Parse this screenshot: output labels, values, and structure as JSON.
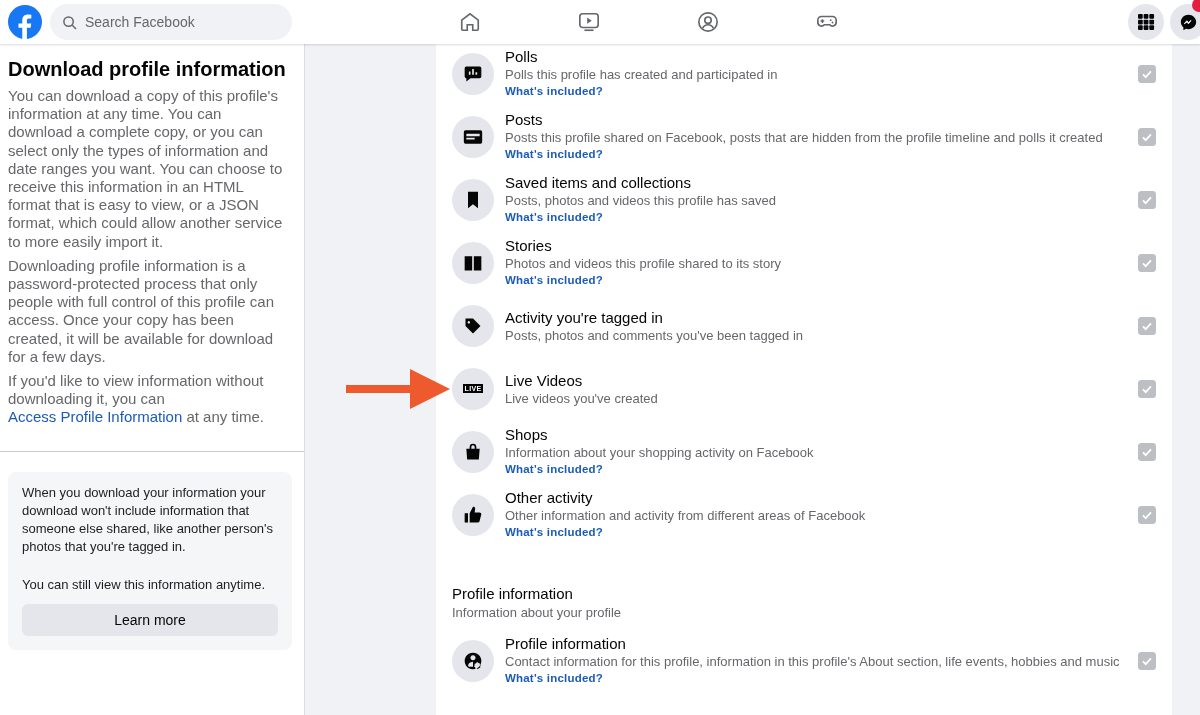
{
  "header": {
    "search": {
      "placeholder": "Search Facebook"
    },
    "notification_badge": true
  },
  "sidebar": {
    "title": "Download profile information",
    "paragraphs": [
      "You can download a copy of this profile's information at any time. You can download a complete copy, or you can select only the types of information and date ranges you want. You can choose to receive this information in an HTML format that is easy to view, or a JSON format, which could allow another service to more easily import it.",
      "Downloading profile information is a password-protected process that only people with full control of this profile can access. Once your copy has been created, it will be available for download for a few days."
    ],
    "access_note": {
      "before": "If you'd like to view information without downloading it, you can",
      "link": "Access Profile Information",
      "after": "at any time."
    },
    "info_box": {
      "paragraphs": [
        "When you download your information your download won't include information that someone else shared, like another person's photos that you're tagged in.",
        "You can still view this information anytime."
      ],
      "button": "Learn more"
    }
  },
  "sections": [
    {
      "items": [
        {
          "title": "Polls",
          "description": "Polls this profile has created and participated in",
          "link": "What's included?",
          "checked": true,
          "disabled": true
        },
        {
          "title": "Posts",
          "description": "Posts this profile shared on Facebook, posts that are hidden from the profile timeline and polls it created",
          "link": "What's included?",
          "checked": true,
          "disabled": true
        },
        {
          "title": "Saved items and collections",
          "description": "Posts, photos and videos this profile has saved",
          "link": "What's included?",
          "checked": true,
          "disabled": true
        },
        {
          "title": "Stories",
          "description": "Photos and videos this profile shared to its story",
          "link": "What's included?",
          "checked": true,
          "disabled": true
        },
        {
          "title": "Activity you're tagged in",
          "description": "Posts, photos and comments you've been tagged in",
          "checked": true,
          "disabled": true
        },
        {
          "title": "Live Videos",
          "description": "Live videos you've created",
          "icon_text": "LIVE",
          "highlighted": true,
          "checked": true,
          "disabled": true
        },
        {
          "title": "Shops",
          "description": "Information about your shopping activity on Facebook",
          "link": "What's included?",
          "checked": true,
          "disabled": true
        },
        {
          "title": "Other activity",
          "description": "Other information and activity from different areas of Facebook",
          "link": "What's included?",
          "checked": true,
          "disabled": true
        }
      ]
    },
    {
      "title": "Profile information",
      "subtitle": "Information about your profile",
      "items": [
        {
          "title": "Profile information",
          "description": "Contact information for this profile, information in this profile's About section, life events, hobbies and music",
          "link": "What's included?",
          "checked": true,
          "disabled": true
        }
      ]
    }
  ]
}
